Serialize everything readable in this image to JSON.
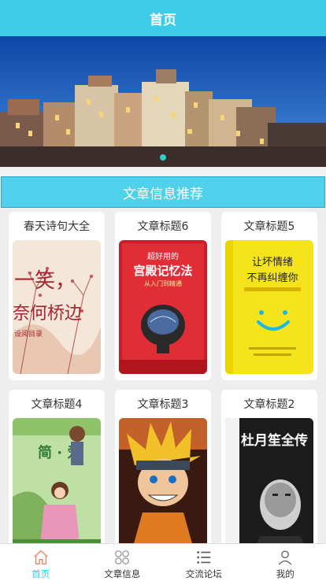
{
  "header": {
    "title": "首页"
  },
  "section": {
    "title": "文章信息推荐"
  },
  "articles": [
    {
      "title": "春天诗句大全",
      "cover_text_1": "一笑，",
      "cover_text_2": "奈何桥边",
      "cover_text_3": "设阅目录"
    },
    {
      "title": "文章标题6",
      "cover_text_1": "超好用的",
      "cover_text_2": "宫殿记忆法",
      "cover_text_3": "从入门到精通"
    },
    {
      "title": "文章标题5",
      "cover_text_1": "让坏情绪",
      "cover_text_2": "不再纠缠你"
    },
    {
      "title": "文章标题4",
      "cover_text_1": "简 · 爱"
    },
    {
      "title": "文章标题3"
    },
    {
      "title": "文章标题2",
      "cover_text_1": "杜月笙全传"
    }
  ],
  "tabs": [
    {
      "label": "首页",
      "icon": "home-icon",
      "active": true
    },
    {
      "label": "文章信息",
      "icon": "grid-icon",
      "active": false
    },
    {
      "label": "交流论坛",
      "icon": "list-icon",
      "active": false
    },
    {
      "label": "我的",
      "icon": "user-icon",
      "active": false
    }
  ],
  "colors": {
    "accent": "#3ecbe8",
    "section": "#4fd0eb",
    "active_tab": "#38c7e6"
  }
}
